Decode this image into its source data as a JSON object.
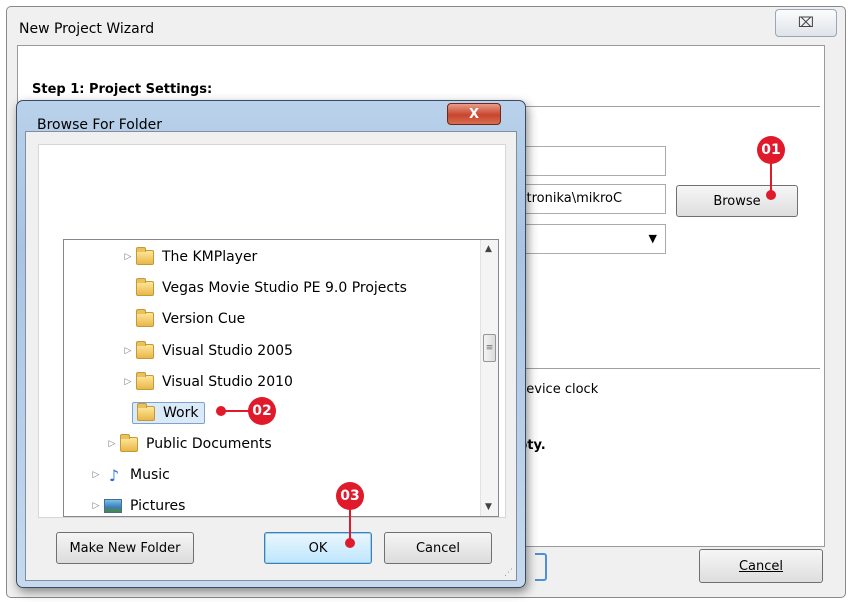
{
  "wizard": {
    "title": "New Project Wizard",
    "close_glyph": "⌧",
    "step_title": "Step 1: Project Settings:",
    "location_value": "ktronika\\mikroC",
    "browse_label": "Browse",
    "select_arrow": "▼",
    "clock_text": "device clock",
    "empty_text": "pty.",
    "cancel_label": "Cancel"
  },
  "browse_dialog": {
    "title": "Browse For Folder",
    "close_glyph": "X",
    "tree_items": [
      {
        "label": "The KMPlayer",
        "icon": "folder-icon",
        "expander": "▷"
      },
      {
        "label": "Vegas Movie Studio PE 9.0 Projects",
        "icon": "folder-icon",
        "expander": ""
      },
      {
        "label": "Version Cue",
        "icon": "folder-icon",
        "expander": ""
      },
      {
        "label": "Visual Studio 2005",
        "icon": "folder-icon",
        "expander": "▷"
      },
      {
        "label": "Visual Studio 2010",
        "icon": "folder-icon",
        "expander": "▷"
      },
      {
        "label": "Work",
        "icon": "folder-icon",
        "expander": "",
        "selected": true
      },
      {
        "label": "Public Documents",
        "icon": "folder-icon",
        "expander": "▷"
      },
      {
        "label": "Music",
        "icon": "music-icon",
        "expander": "▷"
      },
      {
        "label": "Pictures",
        "icon": "pictures-icon",
        "expander": "▷"
      }
    ],
    "make_new_folder_label": "Make New Folder",
    "ok_label": "OK",
    "cancel_label": "Cancel",
    "scroll_up": "▲",
    "scroll_down": "▼",
    "scroll_grip": "≡"
  },
  "callouts": {
    "c1": "01",
    "c2": "02",
    "c3": "03"
  },
  "colors": {
    "callout": "#e0192b",
    "selection": "#dbeaf9"
  }
}
